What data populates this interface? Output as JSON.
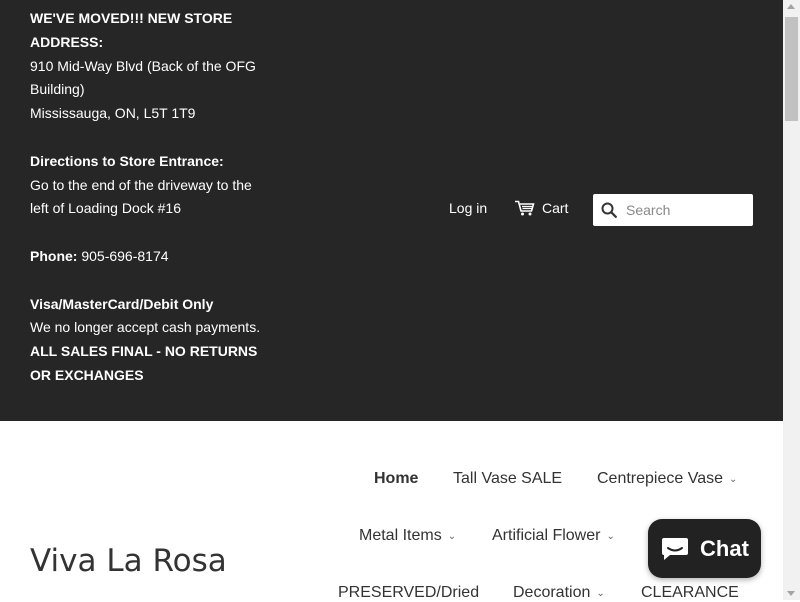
{
  "announcement": {
    "line1": "WE'VE MOVED!!! NEW STORE",
    "line2": "ADDRESS:",
    "line3": "910 Mid-Way Blvd (Back of the OFG",
    "line4": "Building)",
    "line5": "Mississauga, ON, L5T 1T9",
    "directions_heading": "Directions to Store Entrance:",
    "directions_1": "Go to the end of the driveway to the",
    "directions_2": "left of Loading Dock #16",
    "phone_label": "Phone:",
    "phone_value": " 905-696-8174",
    "payment_heading": "Visa/MasterCard/Debit Only",
    "payment_note": "We no longer accept cash payments.",
    "final_1": "ALL SALES FINAL - NO RETURNS",
    "final_2": "OR EXCHANGES"
  },
  "header": {
    "login_label": "Log in",
    "cart_label": "Cart",
    "search_placeholder": "Search"
  },
  "store_name": "Viva La Rosa",
  "nav": [
    {
      "label": "Home",
      "active": true
    },
    {
      "label": "Tall Vase SALE"
    },
    {
      "label": "Centrepiece Vase",
      "dropdown": true
    },
    {
      "label": "Metal Items",
      "dropdown": true
    },
    {
      "label": "Artificial Flower",
      "dropdown": true
    },
    {
      "label": "PRESERVED/Dried"
    },
    {
      "label": "Decoration",
      "dropdown": true
    },
    {
      "label": "CLEARANCE"
    }
  ],
  "chat": {
    "label": "Chat"
  },
  "colors": {
    "topbar_bg": "#262626",
    "chat_bg": "#222222"
  }
}
